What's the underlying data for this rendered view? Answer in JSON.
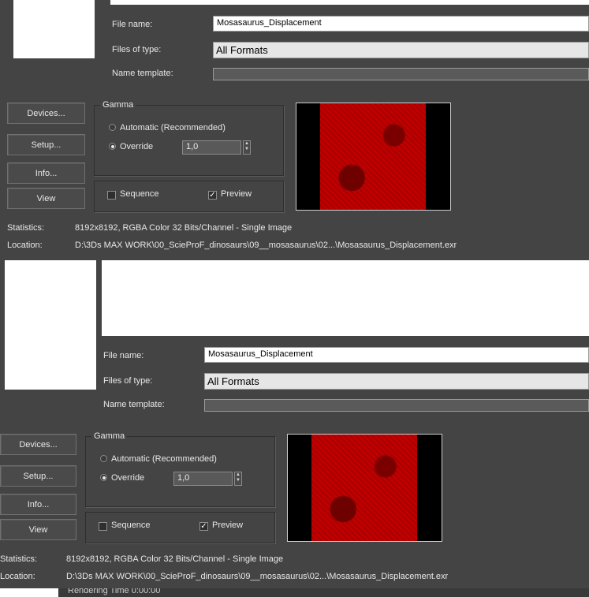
{
  "panels": [
    {
      "file_name_label": "File name:",
      "file_name_value": "Mosasaurus_Displacement",
      "files_of_type_label": "Files of type:",
      "files_of_type_value": "All Formats",
      "name_template_label": "Name template:",
      "buttons": {
        "devices": "Devices...",
        "setup": "Setup...",
        "info": "Info...",
        "view": "View"
      },
      "gamma": {
        "title": "Gamma",
        "automatic_label": "Automatic (Recommended)",
        "override_label": "Override",
        "override_value": "1,0",
        "selected": "override"
      },
      "sequence_label": "Sequence",
      "sequence_checked": false,
      "preview_label": "Preview",
      "preview_checked": true,
      "statistics_label": "Statistics:",
      "statistics_value": "8192x8192, RGBA Color 32 Bits/Channel - Single Image",
      "location_label": "Location:",
      "location_value": "D:\\3Ds MAX WORK\\00_ScieProF_dinosaurs\\09__mosasaurus\\02...\\Mosasaurus_Displacement.exr"
    },
    {
      "file_name_label": "File name:",
      "file_name_value": "Mosasaurus_Displacement",
      "files_of_type_label": "Files of type:",
      "files_of_type_value": "All Formats",
      "name_template_label": "Name template:",
      "buttons": {
        "devices": "Devices...",
        "setup": "Setup...",
        "info": "Info...",
        "view": "View"
      },
      "gamma": {
        "title": "Gamma",
        "automatic_label": "Automatic (Recommended)",
        "override_label": "Override",
        "override_value": "1,0",
        "selected": "override"
      },
      "sequence_label": "Sequence",
      "sequence_checked": false,
      "preview_label": "Preview",
      "preview_checked": true,
      "statistics_label": "Statistics:",
      "statistics_value": "8192x8192, RGBA Color 32 Bits/Channel - Single Image",
      "location_label": "Location:",
      "location_value": "D:\\3Ds MAX WORK\\00_ScieProF_dinosaurs\\09__mosasaurus\\02...\\Mosasaurus_Displacement.exr"
    }
  ],
  "footer": {
    "rendering_time": "Rendering Time 0:00:00"
  },
  "colors": {
    "panel_bg": "#444444",
    "texture_red": "#c00000"
  }
}
